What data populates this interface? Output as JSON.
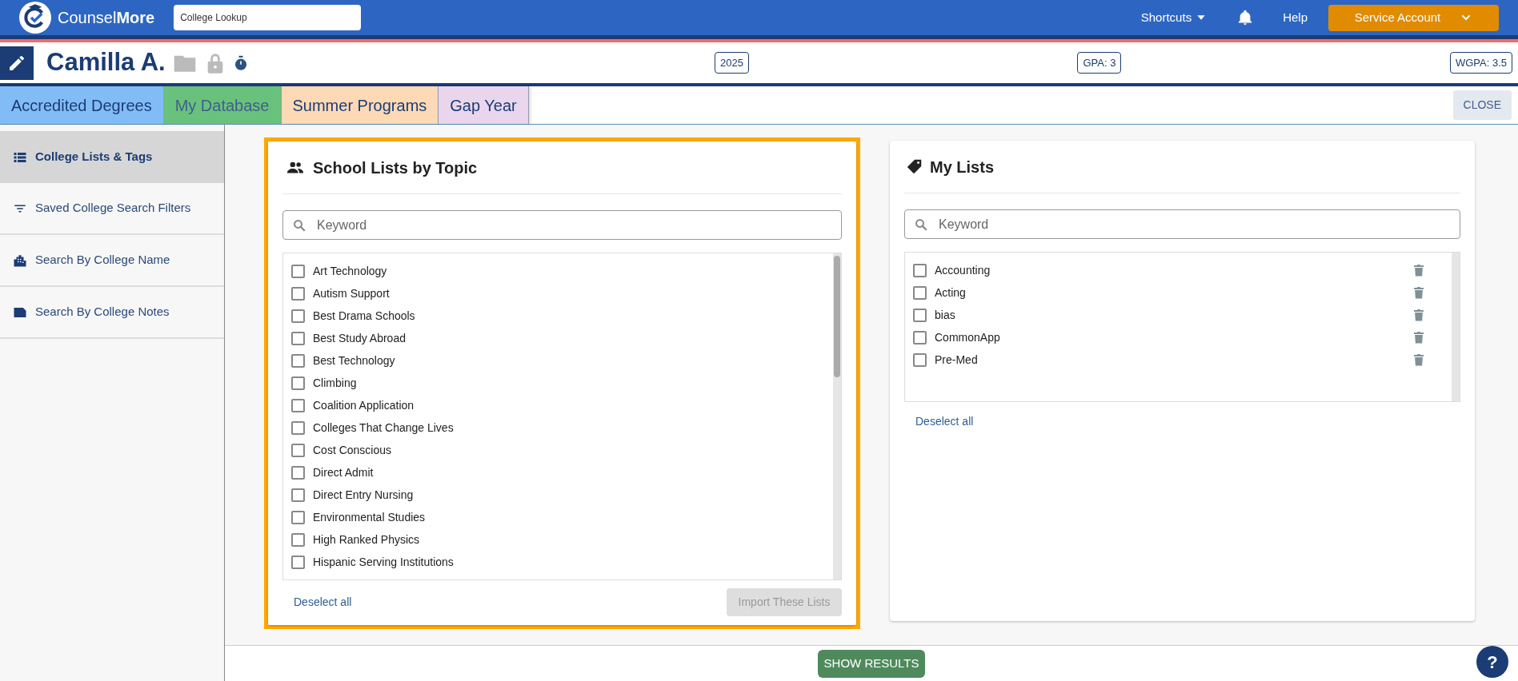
{
  "navbar": {
    "brand": "Counsel**More**",
    "lookup": {
      "value": "College Lookup"
    },
    "links": [
      {
        "kind": "dropdown",
        "label": "Shortcuts"
      },
      {
        "kind": "bell"
      },
      {
        "kind": "link",
        "label": "Help"
      }
    ],
    "account": "Service Account"
  },
  "student": {
    "name": "Camilla A.",
    "badges": [
      "2025",
      "GPA: 3",
      "WGPA: 3.5"
    ]
  },
  "tabs": [
    {
      "label": "Accredited Degrees",
      "color": "#82bcf7",
      "selected": false
    },
    {
      "label": "My Database",
      "color": "#69c27c",
      "selected": true
    },
    {
      "label": "Summer Programs",
      "color": "#fdd9b6",
      "selected": false
    },
    {
      "label": "Gap Year",
      "color": "#e9d6ec",
      "selected": false
    }
  ],
  "close_button": "CLOSE",
  "sidebar": {
    "items": [
      {
        "kind": "list",
        "label": "College Lists & Tags",
        "selected": true
      },
      {
        "kind": "filter",
        "label": "Saved College Search Filters",
        "selected": false
      },
      {
        "kind": "building",
        "label": "Search By College Name",
        "selected": false
      },
      {
        "kind": "note",
        "label": "Search By College Notes",
        "selected": false
      }
    ]
  },
  "topic_lists": {
    "title": "School Lists by Topic",
    "search": {
      "placeholder": "Keyword"
    },
    "items": [
      {
        "label": "Art Technology",
        "checked": false
      },
      {
        "label": "Autism Support",
        "checked": false
      },
      {
        "label": "Best Drama Schools",
        "checked": false
      },
      {
        "label": "Best Study Abroad",
        "checked": false
      },
      {
        "label": "Best Technology",
        "checked": false
      },
      {
        "label": "Climbing",
        "checked": false
      },
      {
        "label": "Coalition Application",
        "checked": false
      },
      {
        "label": "Colleges That Change Lives",
        "checked": false
      },
      {
        "label": "Cost Conscious",
        "checked": false
      },
      {
        "label": "Direct Admit",
        "checked": false
      },
      {
        "label": "Direct Entry Nursing",
        "checked": false
      },
      {
        "label": "Environmental Studies",
        "checked": false
      },
      {
        "label": "High Ranked Physics",
        "checked": false
      },
      {
        "label": "Hispanic Serving Institutions",
        "checked": false
      }
    ],
    "deselect": "Deselect all",
    "import_button": {
      "label": "Import These Lists",
      "disabled": true
    }
  },
  "my_lists": {
    "title": "My Lists",
    "search": {
      "placeholder": "Keyword"
    },
    "items": [
      {
        "label": "Accounting",
        "checked": false
      },
      {
        "label": "Acting",
        "checked": false
      },
      {
        "label": "bias",
        "checked": false
      },
      {
        "label": "CommonApp",
        "checked": false
      },
      {
        "label": "Pre-Med",
        "checked": false
      }
    ],
    "deselect": "Deselect all"
  },
  "show_results": "SHOW RESULTS",
  "help": "?"
}
